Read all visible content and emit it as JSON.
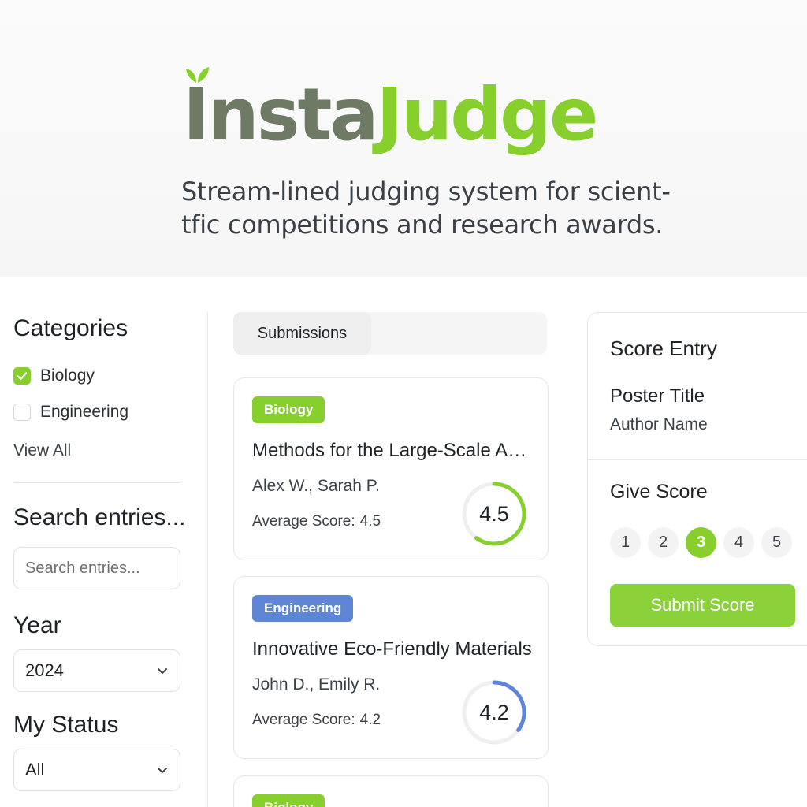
{
  "brand": {
    "name_part1": "Insta",
    "name_part2": "Judge",
    "tagline_line1": "Stream-lined judging system for scient-",
    "tagline_line2": "tfic competitions and research awards.",
    "color_primary": "#6e7a63",
    "color_accent": "#86cf2c",
    "icon": "sprout-icon"
  },
  "sidebar": {
    "categories_heading": "Categories",
    "categories": [
      {
        "label": "Biology",
        "checked": true
      },
      {
        "label": "Engineering",
        "checked": false
      }
    ],
    "view_all": "View All",
    "search_heading": "Search entries...",
    "search_placeholder": "Search entries...",
    "year_heading": "Year",
    "year_value": "2024",
    "status_heading": "My Status",
    "status_value": "All"
  },
  "main": {
    "tab_label": "Submissions",
    "submissions": [
      {
        "category": "Biology",
        "category_color": "#86cf2c",
        "title": "Methods for the Large-Scale Analysis",
        "authors": "Alex W., Sarah P.",
        "avg_label": "Average Score:",
        "avg_score": "4.5",
        "score_fraction": 0.6,
        "ring_color": "#86cf2c"
      },
      {
        "category": "Engineering",
        "category_color": "#5f86d6",
        "title": "Innovative Eco-Friendly Materials",
        "authors": "John D., Emily R.",
        "avg_label": "Average Score:",
        "avg_score": "4.2",
        "score_fraction": 0.35,
        "ring_color": "#5f86d6"
      },
      {
        "category": "Biology",
        "category_color": "#86cf2c"
      }
    ]
  },
  "score_panel": {
    "title": "Score Entry",
    "poster_title": "Poster Title",
    "author_name": "Author Name",
    "give_score": "Give Score",
    "options": [
      "1",
      "2",
      "3",
      "4",
      "5"
    ],
    "selected": "3",
    "submit_label": "Submit Score"
  }
}
